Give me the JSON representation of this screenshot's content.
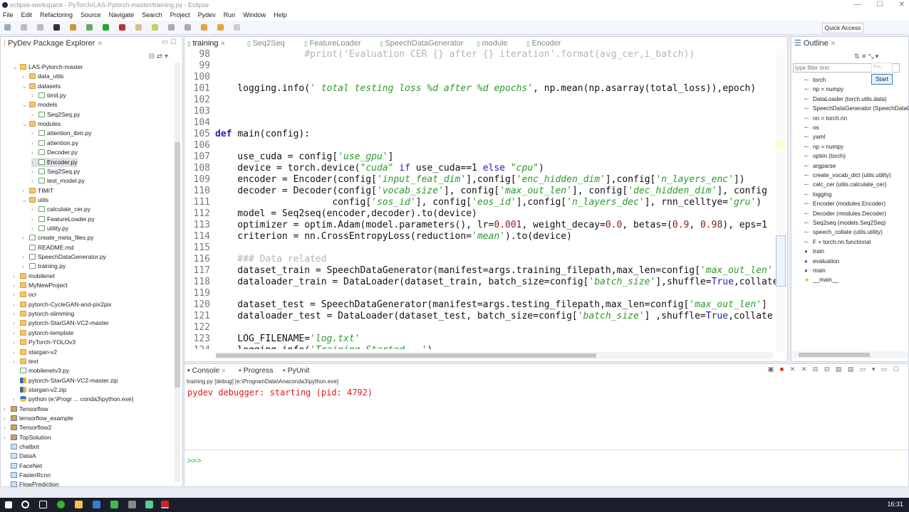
{
  "window": {
    "title": "eclipse-workspace - PyTorch/LAS-Pytorch-master/training.py - Eclipse"
  },
  "menu": [
    "File",
    "Edit",
    "Refactoring",
    "Source",
    "Navigate",
    "Search",
    "Project",
    "Pydev",
    "Run",
    "Window",
    "Help"
  ],
  "quick_access": "Quick Access",
  "explorer": {
    "title": "PyDev Package Explorer",
    "items": [
      {
        "l": 1,
        "e": "v",
        "i": "folder",
        "t": "LAS-Pytorch-master"
      },
      {
        "l": 2,
        "e": ">",
        "i": "folder",
        "t": "data_utils"
      },
      {
        "l": 2,
        "e": "v",
        "i": "folder",
        "t": "datasets"
      },
      {
        "l": 3,
        "e": ">",
        "i": "py",
        "t": "timit.py"
      },
      {
        "l": 2,
        "e": "v",
        "i": "folder",
        "t": "models"
      },
      {
        "l": 3,
        "e": ">",
        "i": "py",
        "t": "Seq2Seq.py"
      },
      {
        "l": 2,
        "e": "v",
        "i": "folder",
        "t": "modules"
      },
      {
        "l": 3,
        "e": ">",
        "i": "py",
        "t": "attention_ibm.py"
      },
      {
        "l": 3,
        "e": ">",
        "i": "py",
        "t": "attention.py"
      },
      {
        "l": 3,
        "e": ">",
        "i": "py",
        "t": "Decoder.py"
      },
      {
        "l": 3,
        "e": ">",
        "i": "py",
        "t": "Encoder.py",
        "sel": true
      },
      {
        "l": 3,
        "e": ">",
        "i": "py",
        "t": "Seq2Seq.py"
      },
      {
        "l": 3,
        "e": ">",
        "i": "py",
        "t": "test_model.py"
      },
      {
        "l": 2,
        "e": ">",
        "i": "folder",
        "t": "TIMIT"
      },
      {
        "l": 2,
        "e": "v",
        "i": "folder",
        "t": "utils"
      },
      {
        "l": 3,
        "e": ">",
        "i": "py",
        "t": "calculate_cer.py"
      },
      {
        "l": 3,
        "e": ">",
        "i": "py",
        "t": "FeatureLoader.py"
      },
      {
        "l": 3,
        "e": ">",
        "i": "py",
        "t": "utility.py"
      },
      {
        "l": 2,
        "e": ">",
        "i": "py",
        "t": "create_meta_files.py"
      },
      {
        "l": 2,
        "e": "",
        "i": "md",
        "t": "README.md"
      },
      {
        "l": 2,
        "e": ">",
        "i": "py",
        "t": "SpeechDataGenerator.py"
      },
      {
        "l": 2,
        "e": ">",
        "i": "py",
        "t": "training.py"
      },
      {
        "l": 1,
        "e": ">",
        "i": "folder",
        "t": "mobilenet"
      },
      {
        "l": 1,
        "e": ">",
        "i": "folder",
        "t": "MyNewProject"
      },
      {
        "l": 1,
        "e": ">",
        "i": "folder",
        "t": "ocr"
      },
      {
        "l": 1,
        "e": ">",
        "i": "folder",
        "t": "pytorch-CycleGAN-and-pix2pix"
      },
      {
        "l": 1,
        "e": ">",
        "i": "folder",
        "t": "pytorch-slimming"
      },
      {
        "l": 1,
        "e": ">",
        "i": "folder",
        "t": "pytorch-StarGAN-VC2-master"
      },
      {
        "l": 1,
        "e": ">",
        "i": "folder",
        "t": "pytorch-template"
      },
      {
        "l": 1,
        "e": ">",
        "i": "folder",
        "t": "PyTorch-YOLOv3"
      },
      {
        "l": 1,
        "e": ">",
        "i": "folder",
        "t": "stargan-v2"
      },
      {
        "l": 1,
        "e": ">",
        "i": "folder",
        "t": "text"
      },
      {
        "l": 1,
        "e": "",
        "i": "py",
        "t": "mobilenetv3.py"
      },
      {
        "l": 1,
        "e": "",
        "i": "zip",
        "t": "pytorch-StarGAN-VC2-master.zip"
      },
      {
        "l": 1,
        "e": "",
        "i": "zip",
        "t": "stargan-v2.zip"
      },
      {
        "l": 1,
        "e": ">",
        "i": "pyint",
        "t": "python  (e:\\Progr ... conda3\\python.exe)"
      },
      {
        "l": 0,
        "e": ">",
        "i": "proj",
        "t": "Tensorflow"
      },
      {
        "l": 0,
        "e": ">",
        "i": "proj",
        "t": "tensorflow_example"
      },
      {
        "l": 0,
        "e": ">",
        "i": "proj",
        "t": "Tensorflow2"
      },
      {
        "l": 0,
        "e": ">",
        "i": "proj",
        "t": "TopSolution"
      },
      {
        "l": 0,
        "e": "",
        "i": "fold2",
        "t": "chatbot"
      },
      {
        "l": 0,
        "e": "",
        "i": "fold2",
        "t": "DataA"
      },
      {
        "l": 0,
        "e": "",
        "i": "fold2",
        "t": "FaceNet"
      },
      {
        "l": 0,
        "e": "",
        "i": "fold2",
        "t": "FasterRcnn"
      },
      {
        "l": 0,
        "e": "",
        "i": "fold2",
        "t": "FlowPrediction"
      }
    ]
  },
  "editor": {
    "tabs": [
      "training",
      "Seq2Seq",
      "FeatureLoader",
      "SpeechDataGenerator",
      "module",
      "Encoder"
    ],
    "lines": [
      {
        "n": "98",
        "s": [
          [
            "c",
            "                #print('Evaluation CER {} after {} iteration'.format(avg_cer,i_batch))"
          ]
        ]
      },
      {
        "n": "99",
        "s": []
      },
      {
        "n": "100",
        "s": []
      },
      {
        "n": "101",
        "s": [
          [
            "t",
            "    logging.info("
          ],
          [
            "s",
            "' total testing loss %d after %d epochs'"
          ],
          [
            "t",
            ", np.mean(np.asarray(total_loss)),epoch)"
          ]
        ]
      },
      {
        "n": "102",
        "s": []
      },
      {
        "n": "103",
        "s": []
      },
      {
        "n": "104",
        "s": []
      },
      {
        "n": "105",
        "s": [
          [
            "kb",
            "def "
          ],
          [
            "t",
            "main(config):"
          ]
        ]
      },
      {
        "n": "106",
        "s": []
      },
      {
        "n": "107",
        "s": [
          [
            "t",
            "    use_cuda = config["
          ],
          [
            "s",
            "'use_gpu'"
          ],
          [
            "t",
            "]"
          ]
        ]
      },
      {
        "n": "108",
        "s": [
          [
            "t",
            "    device = torch.device("
          ],
          [
            "s",
            "\"cuda\""
          ],
          [
            "k",
            " if "
          ],
          [
            "t",
            "use_cuda==1"
          ],
          [
            "k",
            " else "
          ],
          [
            "s",
            "\"cpu\""
          ],
          [
            "t",
            ")"
          ]
        ]
      },
      {
        "n": "109",
        "s": [
          [
            "t",
            "    encoder = Encoder(config["
          ],
          [
            "s",
            "'input_feat_dim'"
          ],
          [
            "t",
            "],config["
          ],
          [
            "s",
            "'enc_hidden_dim'"
          ],
          [
            "t",
            "],config["
          ],
          [
            "s",
            "'n_layers_enc'"
          ],
          [
            "t",
            "])"
          ]
        ]
      },
      {
        "n": "110",
        "s": [
          [
            "t",
            "    decoder = Decoder(config["
          ],
          [
            "s",
            "'vocab_size'"
          ],
          [
            "t",
            "], config["
          ],
          [
            "s",
            "'max_out_len'"
          ],
          [
            "t",
            "], config["
          ],
          [
            "s",
            "'dec_hidden_dim'"
          ],
          [
            "t",
            "], config"
          ]
        ]
      },
      {
        "n": "111",
        "s": [
          [
            "t",
            "                     config["
          ],
          [
            "s",
            "'sos_id'"
          ],
          [
            "t",
            "], config["
          ],
          [
            "s",
            "'eos_id'"
          ],
          [
            "t",
            "],config["
          ],
          [
            "s",
            "'n_layers_dec'"
          ],
          [
            "t",
            "], rnn_celltye="
          ],
          [
            "s",
            "'gru'"
          ],
          [
            "t",
            ")"
          ]
        ]
      },
      {
        "n": "112",
        "s": [
          [
            "t",
            "    model = Seq2seq(encoder,decoder).to(device)"
          ]
        ]
      },
      {
        "n": "113",
        "s": [
          [
            "t",
            "    optimizer = optim.Adam(model.parameters(), lr="
          ],
          [
            "n",
            "0.001"
          ],
          [
            "t",
            ", weight_decay="
          ],
          [
            "n",
            "0.0"
          ],
          [
            "t",
            ", betas=("
          ],
          [
            "n",
            "0.9"
          ],
          [
            "t",
            ", "
          ],
          [
            "n",
            "0.98"
          ],
          [
            "t",
            "), eps=1"
          ]
        ]
      },
      {
        "n": "114",
        "s": [
          [
            "t",
            "    criterion = nn.CrossEntropyLoss(reduction="
          ],
          [
            "s",
            "'mean'"
          ],
          [
            "t",
            ").to(device)"
          ]
        ]
      },
      {
        "n": "115",
        "s": []
      },
      {
        "n": "116",
        "s": [
          [
            "c",
            "    ### Data related"
          ]
        ]
      },
      {
        "n": "117",
        "s": [
          [
            "t",
            "    dataset_train = SpeechDataGenerator(manifest=args.training_filepath,max_len=config["
          ],
          [
            "s",
            "'max_out_len'"
          ]
        ]
      },
      {
        "n": "118",
        "s": [
          [
            "t",
            "    dataloader_train = DataLoader(dataset_train, batch_size=config["
          ],
          [
            "s",
            "'batch_size'"
          ],
          [
            "t",
            "],shuffle="
          ],
          [
            "k",
            "True"
          ],
          [
            "t",
            ",collate"
          ]
        ]
      },
      {
        "n": "119",
        "s": []
      },
      {
        "n": "120",
        "s": [
          [
            "t",
            "    dataset_test = SpeechDataGenerator(manifest=args.testing_filepath,max_len=config["
          ],
          [
            "s",
            "'max_out_len'"
          ],
          [
            "t",
            "]"
          ]
        ]
      },
      {
        "n": "121",
        "s": [
          [
            "t",
            "    dataloader_test = DataLoader(dataset_test, batch_size=config["
          ],
          [
            "s",
            "'batch_size'"
          ],
          [
            "t",
            "] ,shuffle="
          ],
          [
            "k",
            "True"
          ],
          [
            "t",
            ",collate"
          ]
        ]
      },
      {
        "n": "122",
        "s": []
      },
      {
        "n": "123",
        "s": [
          [
            "t",
            "    LOG_FILENAME="
          ],
          [
            "s",
            "'log.txt'"
          ]
        ]
      },
      {
        "n": "124",
        "s": [
          [
            "t",
            "    logging.info("
          ],
          [
            "s",
            "'Training Started...'"
          ],
          [
            "t",
            ")"
          ]
        ]
      }
    ]
  },
  "outline": {
    "title": "Outline",
    "filter_placeholder": "type filter text",
    "popup_label": "Poi...",
    "start_button": "Start",
    "items": [
      {
        "i": "import",
        "t": "torch"
      },
      {
        "i": "import",
        "t": "np = numpy"
      },
      {
        "i": "import",
        "t": "DataLoader (torch.utils.data)"
      },
      {
        "i": "import",
        "t": "SpeechDataGenerator (SpeechDataGenerator)"
      },
      {
        "i": "import",
        "t": "nn = torch.nn"
      },
      {
        "i": "import",
        "t": "os"
      },
      {
        "i": "import",
        "t": "yaml"
      },
      {
        "i": "import",
        "t": "np = numpy"
      },
      {
        "i": "import",
        "t": "optim (torch)"
      },
      {
        "i": "import",
        "t": "argparse"
      },
      {
        "i": "import",
        "t": "create_vocab_dict (utils.utility)"
      },
      {
        "i": "import",
        "t": "calc_cer (utils.calculate_cer)"
      },
      {
        "i": "import",
        "t": "logging"
      },
      {
        "i": "import",
        "t": "Encoder (modules.Encoder)"
      },
      {
        "i": "import",
        "t": "Decoder (modules.Decoder)"
      },
      {
        "i": "import",
        "t": "Seq2seq (models.Seq2Seq)"
      },
      {
        "i": "import",
        "t": "speech_collate (utils.utility)"
      },
      {
        "i": "import",
        "t": "F = torch.nn.functional"
      },
      {
        "i": "function",
        "t": "train"
      },
      {
        "i": "function",
        "t": "evaluation"
      },
      {
        "i": "function",
        "t": "main"
      },
      {
        "i": "main",
        "t": "__main__"
      }
    ]
  },
  "console": {
    "tabs": [
      "Console",
      "Progress",
      "PyUnit"
    ],
    "process": "training.py [debug] [e:\\ProgramData\\Anaconda3\\python.exe]",
    "output": "pydev debugger: starting (pid: 4792)",
    "prompt": ">>>"
  },
  "taskbar": {
    "time": "16:31"
  }
}
